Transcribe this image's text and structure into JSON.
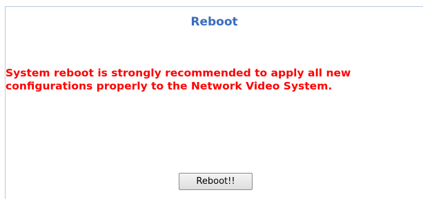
{
  "page": {
    "title": "Reboot",
    "message_line1": "System reboot is strongly recommended to apply all new",
    "message_line2": "configurations properly to the Network Video System.",
    "reboot_button_label": "Reboot!!"
  },
  "colors": {
    "title": "#3b6cc0",
    "warning": "#ff0000",
    "frame_border": "#b9c9dd"
  }
}
